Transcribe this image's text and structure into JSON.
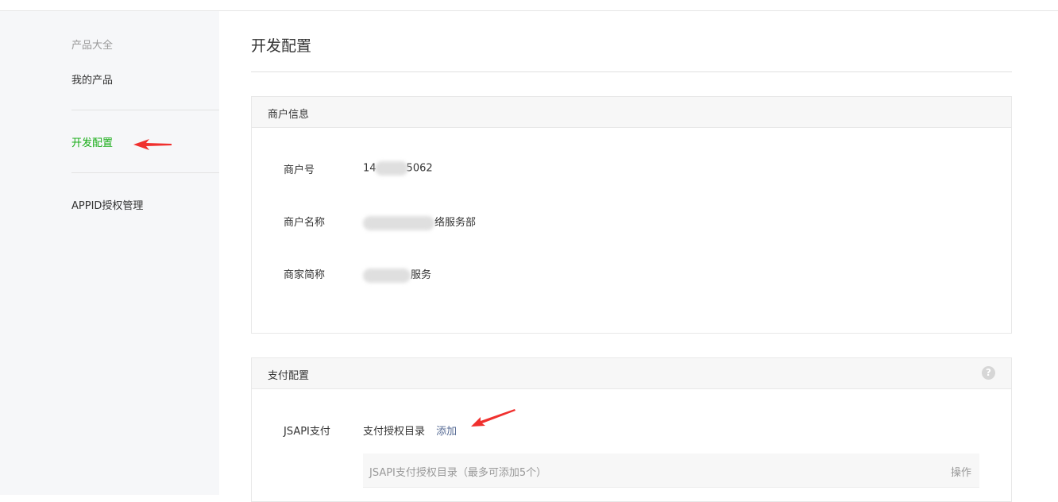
{
  "sidebar": {
    "category": "产品大全",
    "items": [
      {
        "label": "我的产品"
      },
      {
        "label": "开发配置",
        "active": true
      },
      {
        "label": "APPID授权管理"
      }
    ]
  },
  "page": {
    "title": "开发配置"
  },
  "merchant_panel": {
    "title": "商户信息",
    "rows": [
      {
        "label": "商户号",
        "value_prefix": "14",
        "value_suffix": "5062"
      },
      {
        "label": "商户名称",
        "value_suffix": "络服务部"
      },
      {
        "label": "商家简称",
        "value_suffix": "服务"
      }
    ]
  },
  "payment_panel": {
    "title": "支付配置",
    "help_icon": "?",
    "jsapi": {
      "label": "JSAPI支付",
      "dir_label": "支付授权目录",
      "add_link": "添加",
      "table_header": "JSAPI支付授权目录（最多可添加5个）",
      "table_action": "操作"
    }
  },
  "colors": {
    "active_green": "#1aad19",
    "link_blue": "#576b95",
    "annotation_red": "#f0302e"
  }
}
